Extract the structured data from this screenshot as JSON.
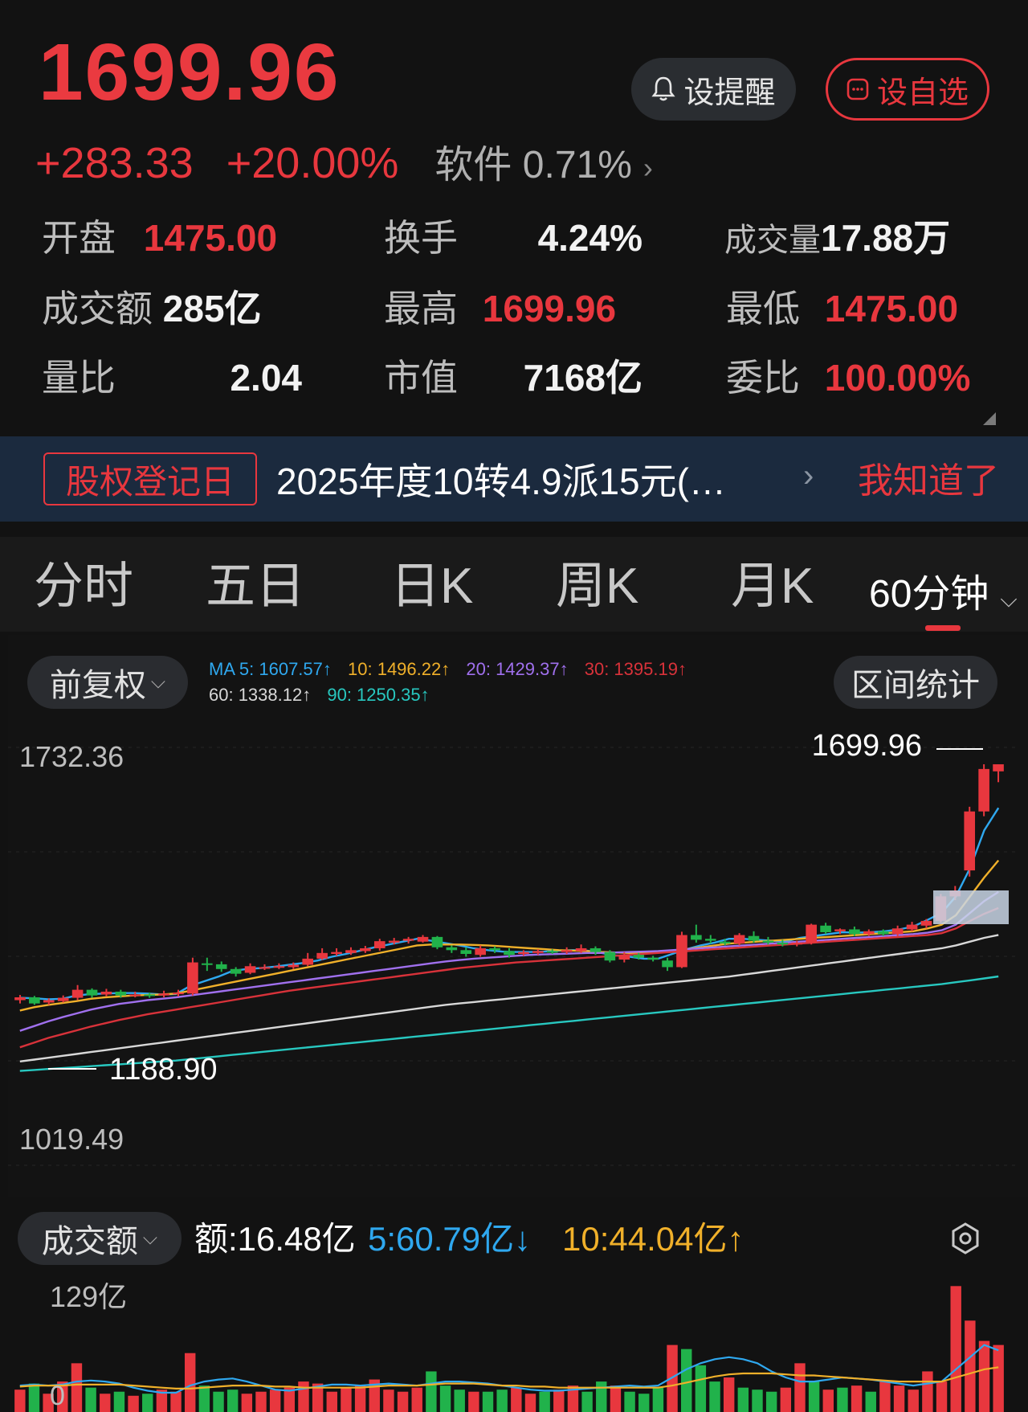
{
  "quote": {
    "price": "1699.96",
    "change": "+283.33",
    "change_pct": "+20.00%",
    "sector_name": "软件",
    "sector_pct": "0.71%"
  },
  "buttons": {
    "alert_label": "设提醒",
    "watchlist_label": "设自选"
  },
  "stats": [
    [
      {
        "label": "开盘",
        "value": "1475.00",
        "color": "red"
      },
      {
        "label": "换手",
        "value": "4.24%",
        "color": "white"
      },
      {
        "label": "成交量",
        "value": "17.88万",
        "color": "white"
      }
    ],
    [
      {
        "label": "成交额",
        "value": "285亿",
        "color": "white"
      },
      {
        "label": "最高",
        "value": "1699.96",
        "color": "red"
      },
      {
        "label": "最低",
        "value": "1475.00",
        "color": "red"
      }
    ],
    [
      {
        "label": "量比",
        "value": "2.04",
        "color": "white"
      },
      {
        "label": "市值",
        "value": "7168亿",
        "color": "white"
      },
      {
        "label": "委比",
        "value": "100.00%",
        "color": "red"
      }
    ]
  ],
  "banner": {
    "tag": "股权登记日",
    "text": "2025年度10转4.9派15元(…",
    "dismiss": "我知道了"
  },
  "tabs": [
    "分时",
    "五日",
    "日K",
    "周K",
    "月K"
  ],
  "active_tab": "60分钟",
  "chart_controls": {
    "adjust_label": "前复权",
    "range_stats_label": "区间统计"
  },
  "ma_legend": [
    {
      "text": "MA 5: 1607.57↑",
      "color": "#2fa8ef"
    },
    {
      "text": "10: 1496.22↑",
      "color": "#f0b02a"
    },
    {
      "text": "20: 1429.37↑",
      "color": "#a070ee"
    },
    {
      "text": "30: 1395.19↑",
      "color": "#d8323a"
    },
    {
      "text": "60: 1338.12↑",
      "color": "#d8d8d8"
    },
    {
      "text": "90: 1250.35↑",
      "color": "#28c8c0"
    }
  ],
  "price_axis": {
    "top": "1732.36",
    "bottom": "1019.49",
    "high_marker": "1699.96",
    "low_marker": "1188.90"
  },
  "volume": {
    "selector_label": "成交额",
    "amount": "额:16.48亿",
    "ma5": "5:60.79亿↓",
    "ma10": "10:44.04亿↑",
    "axis_top": "129亿",
    "axis_bottom": "0"
  },
  "colors": {
    "up": "#e8373e",
    "down": "#21b24b",
    "ma5": "#2fa8ef",
    "ma10": "#f0b02a",
    "ma20": "#a070ee",
    "ma30": "#d8323a",
    "ma60": "#d8d8d8",
    "ma90": "#28c8c0"
  },
  "chart_data": {
    "type": "candlestick",
    "ylim": [
      1019.49,
      1732.36
    ],
    "candles": [
      [
        1200,
        1206,
        1193,
        1211
      ],
      [
        1206,
        1193,
        1190,
        1209
      ],
      [
        1195,
        1200,
        1190,
        1204
      ],
      [
        1198,
        1205,
        1195,
        1210
      ],
      [
        1205,
        1222,
        1200,
        1232
      ],
      [
        1222,
        1210,
        1205,
        1225
      ],
      [
        1212,
        1218,
        1208,
        1224
      ],
      [
        1218,
        1210,
        1205,
        1222
      ],
      [
        1210,
        1212,
        1206,
        1218
      ],
      [
        1212,
        1210,
        1205,
        1216
      ],
      [
        1210,
        1214,
        1206,
        1220
      ],
      [
        1214,
        1216,
        1208,
        1222
      ],
      [
        1214,
        1280,
        1210,
        1290
      ],
      [
        1278,
        1275,
        1262,
        1290
      ],
      [
        1276,
        1266,
        1260,
        1282
      ],
      [
        1266,
        1256,
        1250,
        1270
      ],
      [
        1258,
        1272,
        1255,
        1278
      ],
      [
        1270,
        1270,
        1264,
        1276
      ],
      [
        1270,
        1272,
        1266,
        1278
      ],
      [
        1270,
        1275,
        1266,
        1280
      ],
      [
        1275,
        1288,
        1272,
        1300
      ],
      [
        1288,
        1300,
        1285,
        1310
      ],
      [
        1298,
        1302,
        1294,
        1310
      ],
      [
        1300,
        1306,
        1296,
        1312
      ],
      [
        1304,
        1310,
        1300,
        1315
      ],
      [
        1310,
        1325,
        1305,
        1330
      ],
      [
        1322,
        1326,
        1318,
        1332
      ],
      [
        1326,
        1330,
        1320,
        1334
      ],
      [
        1324,
        1334,
        1322,
        1338
      ],
      [
        1334,
        1312,
        1308,
        1336
      ],
      [
        1312,
        1306,
        1300,
        1316
      ],
      [
        1306,
        1298,
        1292,
        1312
      ],
      [
        1296,
        1310,
        1292,
        1316
      ],
      [
        1310,
        1306,
        1300,
        1314
      ],
      [
        1304,
        1296,
        1290,
        1310
      ],
      [
        1298,
        1302,
        1294,
        1306
      ],
      [
        1300,
        1304,
        1296,
        1308
      ],
      [
        1304,
        1302,
        1298,
        1308
      ],
      [
        1302,
        1306,
        1298,
        1312
      ],
      [
        1304,
        1310,
        1300,
        1318
      ],
      [
        1310,
        1302,
        1296,
        1314
      ],
      [
        1302,
        1284,
        1280,
        1306
      ],
      [
        1286,
        1296,
        1280,
        1302
      ],
      [
        1296,
        1290,
        1286,
        1300
      ],
      [
        1290,
        1286,
        1282,
        1294
      ],
      [
        1284,
        1270,
        1262,
        1290
      ],
      [
        1270,
        1338,
        1268,
        1345
      ],
      [
        1338,
        1328,
        1322,
        1360
      ],
      [
        1330,
        1326,
        1320,
        1338
      ],
      [
        1324,
        1320,
        1316,
        1330
      ],
      [
        1320,
        1338,
        1316,
        1342
      ],
      [
        1336,
        1326,
        1322,
        1346
      ],
      [
        1326,
        1322,
        1318,
        1334
      ],
      [
        1322,
        1318,
        1314,
        1328
      ],
      [
        1318,
        1322,
        1314,
        1326
      ],
      [
        1322,
        1360,
        1318,
        1362
      ],
      [
        1358,
        1344,
        1340,
        1364
      ],
      [
        1346,
        1350,
        1340,
        1352
      ],
      [
        1350,
        1340,
        1336,
        1356
      ],
      [
        1340,
        1346,
        1336,
        1350
      ],
      [
        1346,
        1340,
        1336,
        1350
      ],
      [
        1340,
        1352,
        1336,
        1358
      ],
      [
        1350,
        1360,
        1346,
        1366
      ],
      [
        1358,
        1368,
        1352,
        1372
      ],
      [
        1368,
        1420,
        1364,
        1425
      ],
      [
        1420,
        1432,
        1412,
        1442
      ],
      [
        1475,
        1600,
        1462,
        1610
      ],
      [
        1600,
        1690,
        1590,
        1700
      ],
      [
        1685,
        1699.96,
        1662,
        1699.96
      ]
    ],
    "ma_series": {
      "ma5": [
        1205,
        1204,
        1202,
        1203,
        1210,
        1213,
        1214,
        1215,
        1215,
        1214,
        1212,
        1213,
        1230,
        1240,
        1250,
        1262,
        1266,
        1268,
        1271,
        1275,
        1279,
        1284,
        1292,
        1298,
        1305,
        1312,
        1318,
        1324,
        1330,
        1326,
        1321,
        1316,
        1310,
        1306,
        1303,
        1302,
        1302,
        1303,
        1305,
        1306,
        1305,
        1300,
        1295,
        1292,
        1288,
        1288,
        1298,
        1308,
        1316,
        1322,
        1330,
        1330,
        1328,
        1326,
        1324,
        1332,
        1336,
        1340,
        1344,
        1343,
        1344,
        1346,
        1350,
        1356,
        1370,
        1385,
        1420,
        1480,
        1560,
        1607.57
      ],
      "ma10": [
        1178,
        1185,
        1190,
        1194,
        1198,
        1203,
        1206,
        1208,
        1210,
        1211,
        1212,
        1214,
        1220,
        1226,
        1232,
        1238,
        1244,
        1250,
        1256,
        1262,
        1268,
        1274,
        1280,
        1286,
        1292,
        1298,
        1304,
        1310,
        1316,
        1318,
        1318,
        1318,
        1317,
        1316,
        1314,
        1312,
        1310,
        1308,
        1306,
        1305,
        1304,
        1302,
        1301,
        1300,
        1300,
        1301,
        1304,
        1308,
        1312,
        1316,
        1320,
        1322,
        1324,
        1326,
        1328,
        1330,
        1332,
        1334,
        1336,
        1338,
        1340,
        1342,
        1344,
        1346,
        1352,
        1360,
        1380,
        1420,
        1460,
        1496.22
      ],
      "ma20": [
        1135,
        1145,
        1155,
        1164,
        1172,
        1180,
        1186,
        1192,
        1196,
        1200,
        1203,
        1206,
        1210,
        1214,
        1218,
        1222,
        1226,
        1230,
        1234,
        1238,
        1242,
        1246,
        1250,
        1254,
        1258,
        1262,
        1266,
        1270,
        1274,
        1278,
        1282,
        1285,
        1288,
        1290,
        1292,
        1294,
        1296,
        1297,
        1298,
        1299,
        1300,
        1300,
        1301,
        1302,
        1303,
        1304,
        1306,
        1308,
        1310,
        1312,
        1314,
        1316,
        1318,
        1320,
        1322,
        1324,
        1326,
        1328,
        1330,
        1332,
        1334,
        1336,
        1338,
        1340,
        1343,
        1348,
        1360,
        1385,
        1410,
        1429.37
      ],
      "ma30": [
        1100,
        1110,
        1120,
        1128,
        1136,
        1144,
        1151,
        1158,
        1164,
        1170,
        1175,
        1180,
        1185,
        1190,
        1195,
        1200,
        1205,
        1210,
        1215,
        1220,
        1224,
        1228,
        1232,
        1236,
        1240,
        1244,
        1248,
        1252,
        1256,
        1260,
        1264,
        1268,
        1271,
        1274,
        1277,
        1280,
        1282,
        1284,
        1286,
        1288,
        1290,
        1292,
        1294,
        1296,
        1298,
        1300,
        1302,
        1304,
        1306,
        1308,
        1310,
        1312,
        1314,
        1316,
        1318,
        1320,
        1322,
        1324,
        1326,
        1328,
        1330,
        1332,
        1334,
        1336,
        1338,
        1342,
        1352,
        1368,
        1383,
        1395.19
      ],
      "ma60": [
        1070,
        1074,
        1078,
        1082,
        1086,
        1090,
        1094,
        1098,
        1102,
        1106,
        1110,
        1114,
        1118,
        1122,
        1126,
        1130,
        1134,
        1138,
        1142,
        1146,
        1150,
        1154,
        1158,
        1162,
        1166,
        1170,
        1174,
        1178,
        1182,
        1186,
        1190,
        1193,
        1196,
        1199,
        1202,
        1205,
        1208,
        1211,
        1214,
        1217,
        1220,
        1223,
        1226,
        1229,
        1232,
        1235,
        1238,
        1241,
        1244,
        1247,
        1250,
        1254,
        1258,
        1262,
        1266,
        1270,
        1274,
        1278,
        1282,
        1286,
        1290,
        1294,
        1298,
        1302,
        1306,
        1310,
        1316,
        1324,
        1332,
        1338.12
      ],
      "ma90": [
        1050,
        1052,
        1054,
        1056,
        1058,
        1060,
        1062,
        1064,
        1066,
        1068,
        1070,
        1072,
        1075,
        1078,
        1081,
        1084,
        1087,
        1090,
        1093,
        1096,
        1099,
        1102,
        1105,
        1108,
        1111,
        1114,
        1117,
        1120,
        1123,
        1126,
        1129,
        1132,
        1135,
        1138,
        1141,
        1144,
        1147,
        1150,
        1153,
        1156,
        1159,
        1162,
        1165,
        1168,
        1171,
        1174,
        1177,
        1180,
        1183,
        1186,
        1189,
        1192,
        1195,
        1198,
        1201,
        1204,
        1207,
        1210,
        1213,
        1216,
        1219,
        1222,
        1225,
        1228,
        1231,
        1234,
        1238,
        1242,
        1246,
        1250.35
      ]
    },
    "volume_ylim": [
      0,
      129
    ],
    "volume_values": [
      22,
      28,
      18,
      30,
      48,
      24,
      18,
      20,
      16,
      18,
      22,
      20,
      58,
      26,
      20,
      22,
      18,
      20,
      22,
      24,
      30,
      28,
      20,
      24,
      26,
      32,
      22,
      20,
      24,
      40,
      26,
      22,
      20,
      20,
      22,
      24,
      18,
      20,
      22,
      26,
      20,
      30,
      26,
      20,
      18,
      24,
      66,
      62,
      46,
      30,
      34,
      24,
      22,
      20,
      24,
      48,
      30,
      22,
      24,
      26,
      20,
      30,
      26,
      22,
      40,
      30,
      124,
      90,
      70,
      66
    ],
    "volume_ma": [
      26,
      27,
      26,
      27,
      30,
      31,
      30,
      28,
      24,
      21,
      19,
      19,
      26,
      30,
      32,
      33,
      30,
      26,
      22,
      21,
      23,
      25,
      27,
      27,
      26,
      27,
      28,
      27,
      26,
      28,
      30,
      30,
      29,
      28,
      26,
      24,
      22,
      21,
      21,
      22,
      23,
      24,
      25,
      26,
      25,
      26,
      34,
      42,
      48,
      52,
      54,
      52,
      48,
      40,
      34,
      30,
      30,
      32,
      34,
      33,
      32,
      30,
      28,
      26,
      28,
      30,
      42,
      54,
      66,
      60.79
    ],
    "volume_ma10": [
      25,
      26,
      26,
      26,
      27,
      27,
      27,
      27,
      26,
      25,
      24,
      23,
      23,
      24,
      25,
      26,
      26,
      26,
      25,
      25,
      24,
      24,
      24,
      24,
      24,
      25,
      26,
      26,
      26,
      27,
      28,
      28,
      28,
      27,
      26,
      26,
      25,
      25,
      24,
      24,
      24,
      24,
      24,
      24,
      24,
      24,
      26,
      29,
      32,
      35,
      37,
      38,
      38,
      38,
      37,
      36,
      36,
      35,
      34,
      33,
      32,
      31,
      30,
      30,
      30,
      30,
      34,
      38,
      42,
      44.04
    ]
  }
}
